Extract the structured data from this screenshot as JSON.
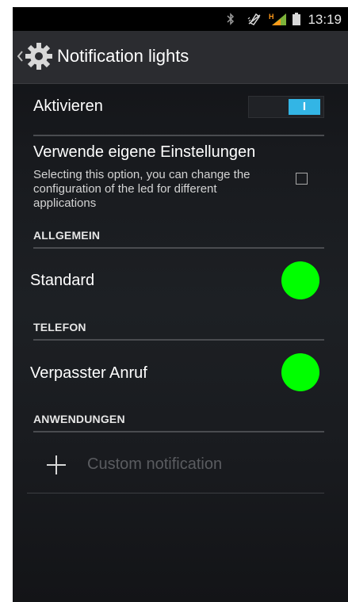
{
  "status_bar": {
    "time": "13:19",
    "icons": [
      "bluetooth-icon",
      "vibrate-icon",
      "signal-icon",
      "battery-icon"
    ],
    "signal_label": "H"
  },
  "action_bar": {
    "title": "Notification lights",
    "icons": [
      "chevron-left-icon",
      "gear-icon"
    ]
  },
  "settings": {
    "activate": {
      "label": "Aktivieren",
      "toggle_label": "I",
      "state": "on"
    },
    "custom_settings": {
      "label": "Verwende eigene Einstellungen",
      "description": "Selecting this option, you can change the configuration of the led for different applications",
      "checked": false
    },
    "sections": [
      {
        "header": "ALLGEMEIN",
        "items": [
          {
            "label": "Standard",
            "led_color": "#00ff00"
          }
        ]
      },
      {
        "header": "TELEFON",
        "items": [
          {
            "label": "Verpasster Anruf",
            "led_color": "#00ff00"
          }
        ]
      },
      {
        "header": "ANWENDUNGEN",
        "items": []
      }
    ],
    "add_custom": {
      "label": "Custom notification",
      "icon": "plus-icon"
    }
  },
  "colors": {
    "accent": "#33b5e5",
    "led_green": "#00ff00",
    "background": "#1a1c20",
    "action_bar": "#2b2c30"
  }
}
